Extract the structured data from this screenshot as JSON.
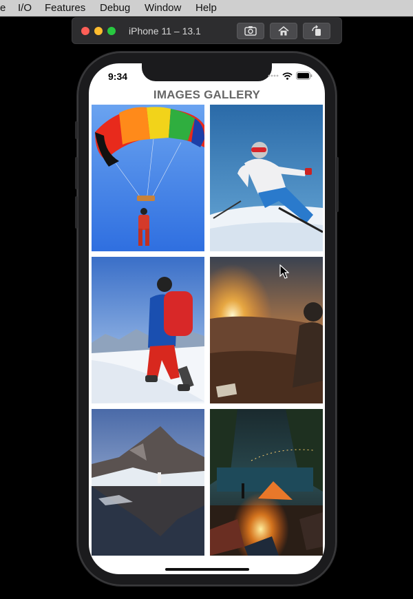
{
  "menu": {
    "items": [
      "e",
      "I/O",
      "Features",
      "Debug",
      "Window",
      "Help"
    ]
  },
  "simulator": {
    "title": "iPhone 11 – 13.1",
    "toolbar": [
      "screenshot-icon",
      "home-icon",
      "rotate-icon"
    ]
  },
  "status_bar": {
    "time": "9:34",
    "icons": [
      "signal-dots-icon",
      "wifi-icon",
      "battery-icon"
    ]
  },
  "app": {
    "title": "IMAGES GALLERY",
    "images": [
      {
        "subject": "paragliding",
        "icon": "photo-paragliding"
      },
      {
        "subject": "skiing",
        "icon": "photo-skier"
      },
      {
        "subject": "mountain hiker",
        "icon": "photo-hiker"
      },
      {
        "subject": "sunset",
        "icon": "photo-sunset"
      },
      {
        "subject": "mountain lake",
        "icon": "photo-mountain-lake"
      },
      {
        "subject": "camping",
        "icon": "photo-campfire"
      }
    ]
  },
  "colors": {
    "title_gray": "#666666",
    "window_bar": "#2d2d2f",
    "menubar": "#cfcfcf"
  }
}
